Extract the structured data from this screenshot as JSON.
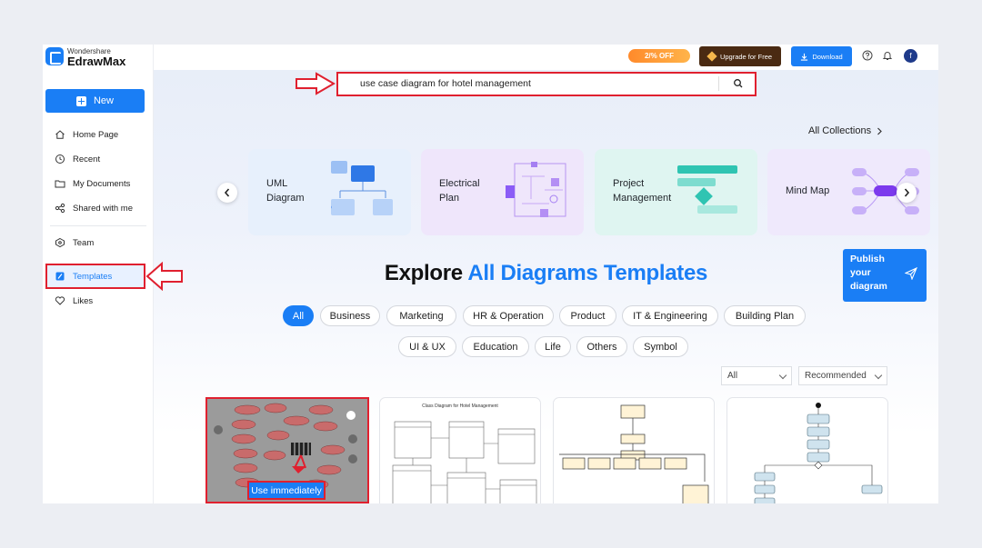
{
  "brand": {
    "company": "Wondershare",
    "product": "EdrawMax"
  },
  "sidebar": {
    "new_label": "New",
    "items": [
      {
        "label": "Home Page",
        "icon": "home-icon"
      },
      {
        "label": "Recent",
        "icon": "clock-icon"
      },
      {
        "label": "My Documents",
        "icon": "folder-icon"
      },
      {
        "label": "Shared with me",
        "icon": "share-icon"
      },
      {
        "label": "Team",
        "icon": "team-icon"
      },
      {
        "label": "Templates",
        "icon": "templates-icon",
        "active": true
      },
      {
        "label": "Likes",
        "icon": "heart-icon"
      }
    ]
  },
  "topbar": {
    "sale_badge": "2/% OFF",
    "upgrade_label": "Upgrade for Free",
    "download_label": "Download",
    "avatar_initial": "f"
  },
  "search": {
    "value": "use case diagram for hotel management"
  },
  "collections": {
    "all_label": "All Collections",
    "cards": [
      {
        "label": "UML\nDiagram",
        "color": "#e7f0fc"
      },
      {
        "label": "Electrical\nPlan",
        "color": "#efe6fb"
      },
      {
        "label": "Project\nManagement",
        "color": "#dff5f1"
      },
      {
        "label": "Mind Map",
        "color": "#efe9fc"
      }
    ]
  },
  "publish": {
    "label": "Publish\nyour\ndiagram"
  },
  "heading": {
    "prefix": "Explore",
    "highlight": "All Diagrams Templates"
  },
  "filters": {
    "row1": [
      "All",
      "Business",
      "Marketing",
      "HR & Operation",
      "Product",
      "IT & Engineering",
      "Building Plan"
    ],
    "row2": [
      "UI & UX",
      "Education",
      "Life",
      "Others",
      "Symbol"
    ],
    "active": "All"
  },
  "sort": {
    "type_value": "All",
    "order_value": "Recommended"
  },
  "templates": {
    "use_label": "Use immediately",
    "card2_title": "Class Diagram for Hotel Management"
  },
  "colors": {
    "accent": "#1a7ef5",
    "highlight_border": "#e0202f"
  }
}
